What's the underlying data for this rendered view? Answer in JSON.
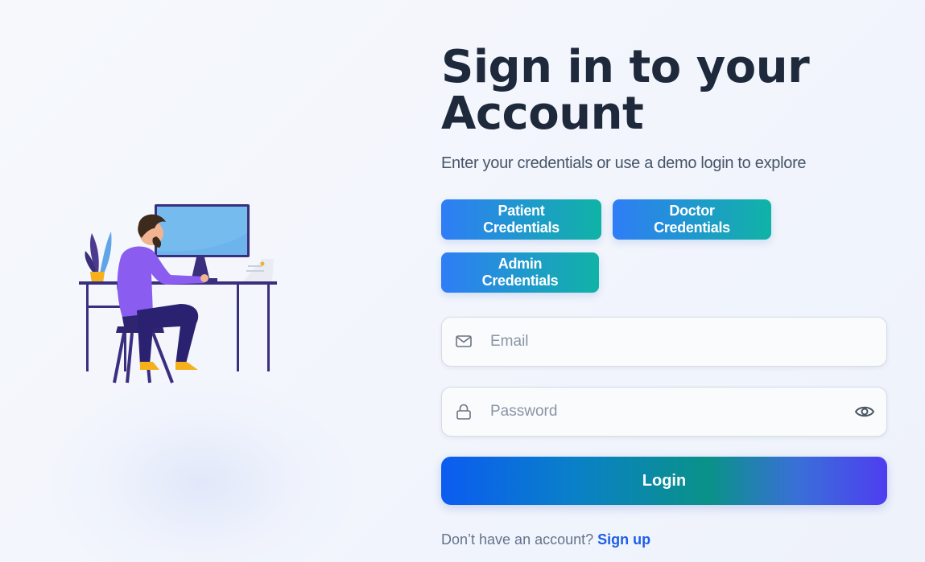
{
  "colors": {
    "title": "#1e293b",
    "subtitle": "#475569",
    "credential_gradient_start": "#2f7df6",
    "credential_gradient_end": "#10b3a6",
    "login_gradient_start": "#0b5cf0",
    "login_gradient_end": "#4d3ef0",
    "link": "#1d5ee8"
  },
  "header": {
    "title": "Sign in to your Account",
    "subtitle": "Enter your credentials or use a demo login to explore"
  },
  "demo_buttons": {
    "patient": "Patient Credentials",
    "doctor": "Doctor Credentials",
    "admin": "Admin Credentials"
  },
  "form": {
    "email": {
      "placeholder": "Email",
      "value": "",
      "icon": "mail-icon"
    },
    "password": {
      "placeholder": "Password",
      "value": "",
      "icon": "lock-icon",
      "toggle_icon": "eye-icon"
    },
    "login_label": "Login"
  },
  "footer": {
    "prompt": "Don’t have an account?",
    "signup_label": "Sign up"
  },
  "illustration": {
    "icon": "person-at-desk-illustration"
  }
}
